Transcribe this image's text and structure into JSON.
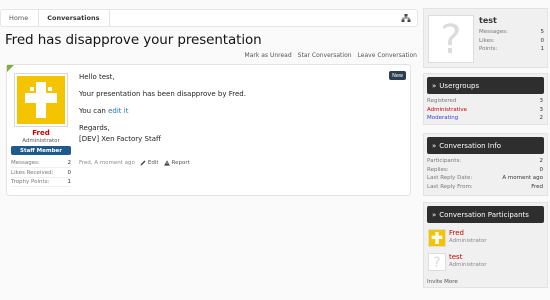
{
  "breadcrumb": {
    "home": "Home",
    "current": "Conversations"
  },
  "title": "Fred has disapprove your presentation",
  "actions": {
    "mark_unread": "Mark as Unread",
    "star": "Star Conversation",
    "leave": "Leave Conversation"
  },
  "message": {
    "badge": "New",
    "author": {
      "name": "Fred",
      "title": "Administrator",
      "banner": "Staff Member",
      "stats": [
        {
          "label": "Messages:",
          "value": "2"
        },
        {
          "label": "Likes Received:",
          "value": "0"
        },
        {
          "label": "Trophy Points:",
          "value": "1"
        }
      ]
    },
    "lines": {
      "greeting": "Hello test,",
      "body": "Your presentation has been disapprove by Fred.",
      "edit_prefix": "You can ",
      "edit_link": "edit it",
      "regards": "Regards,",
      "signature": "[DEV] Xen Factory Staff"
    },
    "meta": {
      "author": "Fred",
      "time": "A moment ago",
      "edit": "Edit",
      "report": "Report"
    }
  },
  "sidebar": {
    "profile": {
      "name": "test",
      "stats": [
        {
          "label": "Messages:",
          "value": "5"
        },
        {
          "label": "Likes:",
          "value": "0"
        },
        {
          "label": "Points:",
          "value": "1"
        }
      ]
    },
    "usergroups": {
      "heading": "Usergroups",
      "rows": [
        {
          "label": "Registered",
          "value": "3",
          "color": "#777777"
        },
        {
          "label": "Administrative",
          "value": "3",
          "color": "#cc0000"
        },
        {
          "label": "Moderating",
          "value": "2",
          "color": "#3a3ad6"
        }
      ]
    },
    "conv_info": {
      "heading": "Conversation Info",
      "rows": [
        {
          "label": "Participants:",
          "value": "2"
        },
        {
          "label": "Replies:",
          "value": "0"
        },
        {
          "label": "Last Reply Date:",
          "value": "A moment ago"
        },
        {
          "label": "Last Reply From:",
          "value": "Fred"
        }
      ]
    },
    "participants": {
      "heading": "Conversation Participants",
      "items": [
        {
          "name": "Fred",
          "title": "Administrator",
          "color": "#cc0000"
        },
        {
          "name": "test",
          "title": "Administrator",
          "color": "#cc0000"
        }
      ],
      "invite": "Invite More"
    }
  },
  "colors": {
    "accent": "#2577b1",
    "admin_red": "#cc0000",
    "staff_blue": "#1f5a8c",
    "heading_dark": "#2e2e2e",
    "new_green": "#7bb33a"
  }
}
